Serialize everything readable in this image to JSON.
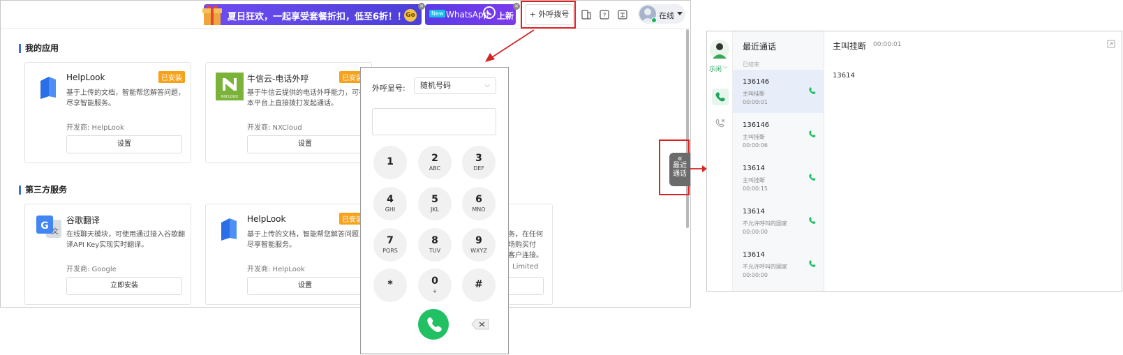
{
  "topbar": {
    "promo_text": "夏日狂欢，一起享受套餐折扣，低至6折！！",
    "promo_go": "Go",
    "whatsapp_new": "New",
    "whatsapp_name": "WhatsApp",
    "whatsapp_up": "上新",
    "callout_button": "+ 外呼拨号",
    "status": "在线"
  },
  "sections": {
    "my_apps": "我的应用",
    "third_party": "第三方服务"
  },
  "apps": [
    {
      "title": "HelpLook",
      "badge": "已安装",
      "desc": "基于上传的文档，智能帮您解答问题，尽享智能服务。",
      "dev": "开发商: HelpLook",
      "button": "设置"
    },
    {
      "title": "牛信云-电话外呼",
      "badge": "已安装",
      "desc": "基于牛信云提供的电话外呼能力，可在本平台上直接拨打发起通话。",
      "dev": "开发商: NXCloud",
      "button": "设置"
    }
  ],
  "services": [
    {
      "title": "谷歌翻译",
      "desc": "在线聊天模块，可使用通过接入谷歌翻译API Key实现实时翻译。",
      "dev": "开发商: Google",
      "button": "立即安装"
    },
    {
      "title": "HelpLook",
      "badge": "已安装",
      "desc": "基于上传的文档，智能帮您解答问题，尽享智能服务。",
      "dev": "开发商: HelpLook",
      "button": "设置"
    }
  ],
  "third_card_fragment": {
    "line1": "务，在任何",
    "line2": "场购买付",
    "line3": "客户连接。",
    "dev": "Limited"
  },
  "nxcloud_logo_text": "NXCLOUD",
  "dialpad": {
    "caller_label": "外呼显号:",
    "caller_value": "随机号码",
    "keys": [
      {
        "d": "1",
        "l": ""
      },
      {
        "d": "2",
        "l": "ABC"
      },
      {
        "d": "3",
        "l": "DEF"
      },
      {
        "d": "4",
        "l": "GHI"
      },
      {
        "d": "5",
        "l": "JKL"
      },
      {
        "d": "6",
        "l": "MNO"
      },
      {
        "d": "7",
        "l": "PQRS"
      },
      {
        "d": "8",
        "l": "TUV"
      },
      {
        "d": "9",
        "l": "WXYZ"
      },
      {
        "d": "*",
        "l": ""
      },
      {
        "d": "0",
        "l": "+"
      },
      {
        "d": "#",
        "l": ""
      }
    ]
  },
  "sidetab": {
    "arrow": "«",
    "line1": "最近",
    "line2": "通话"
  },
  "recent": {
    "agent_status": "示闲",
    "title": "最近通话",
    "group": "已结束",
    "items": [
      {
        "num": "136146",
        "st": "主叫挂断",
        "dur": "00:00:01"
      },
      {
        "num": "136146",
        "st": "主叫挂断",
        "dur": "00:00:06"
      },
      {
        "num": "13614",
        "st": "主叫挂断",
        "dur": "00:00:15"
      },
      {
        "num": "13614",
        "st": "不允许呼叫的国家",
        "dur": "00:00:00"
      },
      {
        "num": "13614",
        "st": "不允许呼叫的国家",
        "dur": "00:00:00"
      }
    ],
    "detail_title": "主叫挂断",
    "detail_time": "00:00:01",
    "detail_number": "13614"
  }
}
